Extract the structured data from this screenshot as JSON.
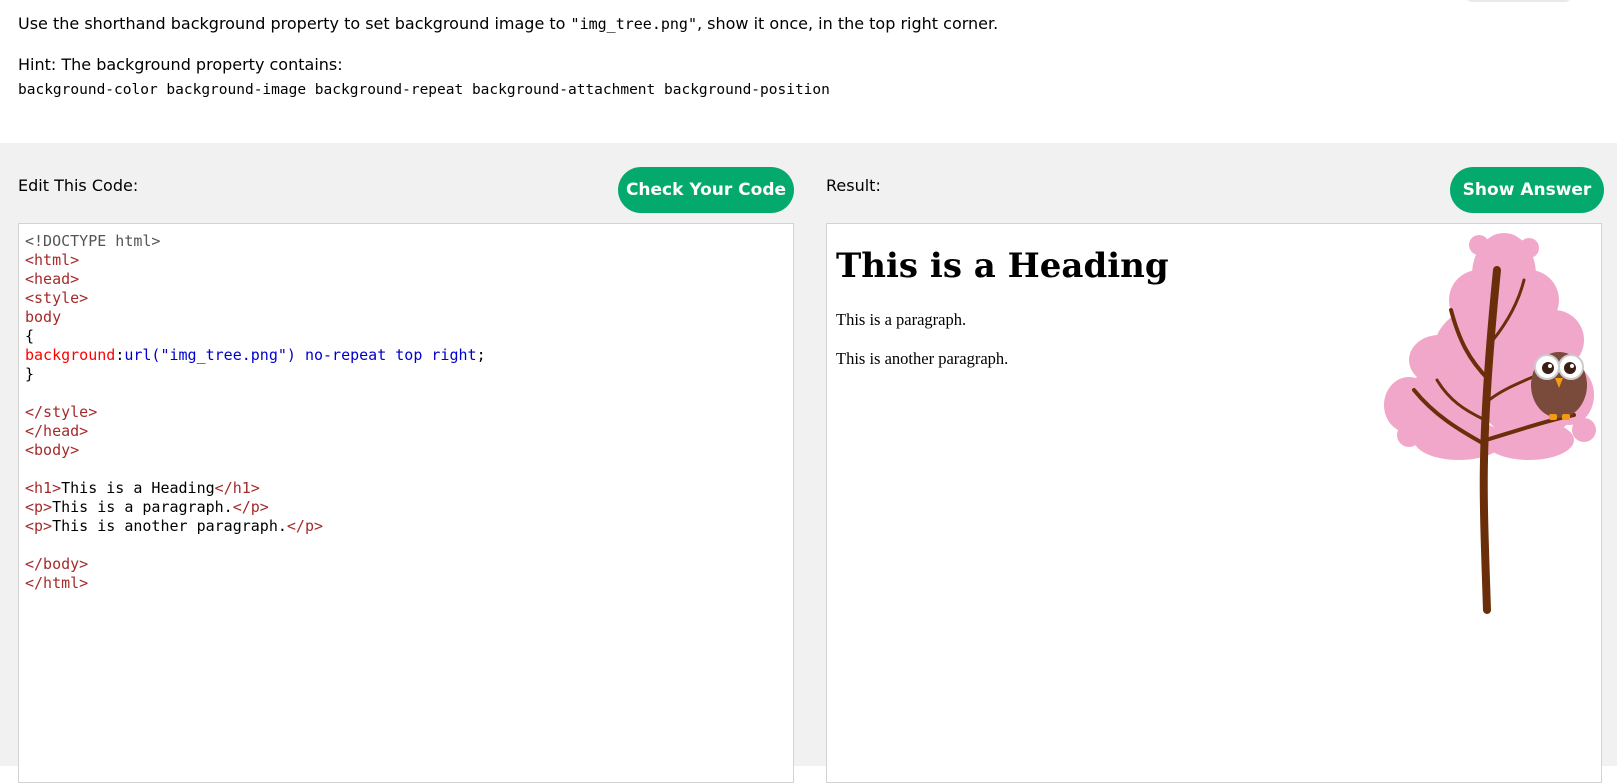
{
  "instructions": {
    "part1": "Use the shorthand background property to set background image to ",
    "code": "\"img_tree.png\"",
    "part2": ", show it once, in the top right corner.",
    "hint": "Hint: The background property contains:",
    "hint_props": "background-color background-image background-repeat background-attachment background-position"
  },
  "editor_pane": {
    "label": "Edit This Code:",
    "button": "Check Your Code"
  },
  "result_pane": {
    "label": "Result:",
    "button": "Show Answer"
  },
  "code": {
    "doctype": "<!DOCTYPE html>",
    "html_open": "<html>",
    "head_open": "<head>",
    "style_open": "<style>",
    "selector": "body",
    "brace_open": "{",
    "prop": "background",
    "colon": ":",
    "url_fn": "url(",
    "url_val": "\"img_tree.png\"",
    "url_close": ")",
    "values": " no-repeat top right",
    "semicolon": ";",
    "brace_close": "}",
    "style_close": "</style>",
    "head_close": "</head>",
    "body_open": "<body>",
    "h1_open": "<h1>",
    "h1_text": "This is a Heading",
    "h1_close": "</h1>",
    "p_open": "<p>",
    "p1_text": "This is a paragraph.",
    "p_close": "</p>",
    "p2_text": "This is another paragraph.",
    "body_close": "</body>",
    "html_close": "</html>"
  },
  "result": {
    "heading": "This is a Heading",
    "p1": "This is a paragraph.",
    "p2": "This is another paragraph.",
    "bg_image": "tree-with-owl-image"
  },
  "colors": {
    "accent": "#04aa6d",
    "workspace_bg": "#f1f1f1",
    "tree_pink": "#f1a7ca",
    "trunk": "#6b2e0a"
  }
}
